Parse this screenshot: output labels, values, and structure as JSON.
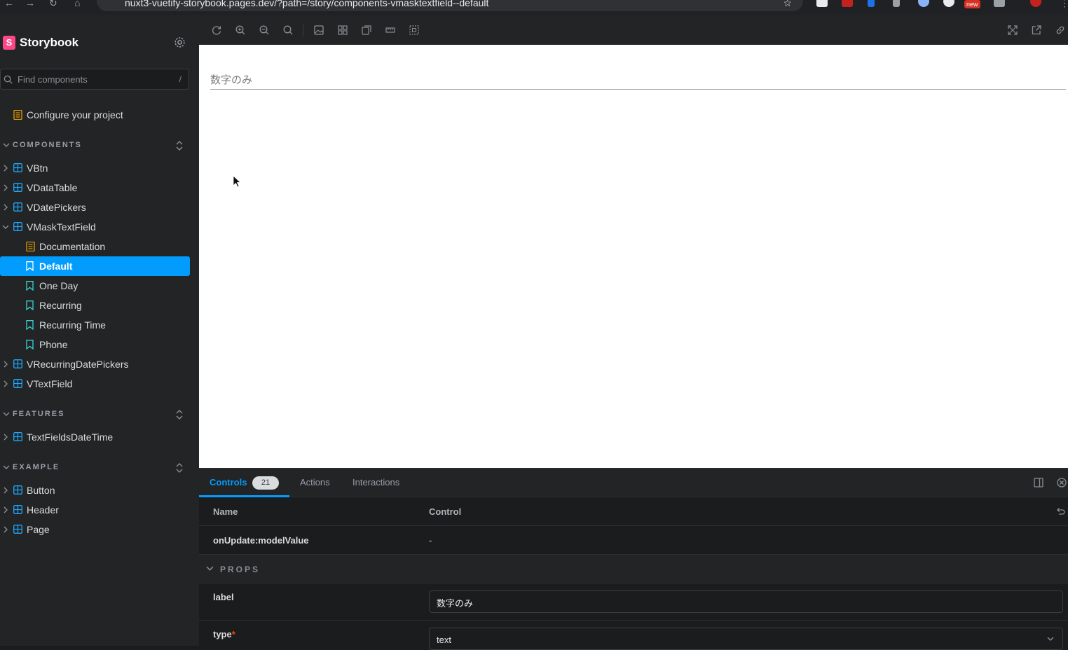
{
  "browser": {
    "url": "nuxt3-vuetify-storybook.pages.dev/?path=/story/components-vmasktextfield--default",
    "new_badge": "new"
  },
  "sidebar": {
    "brand": "Storybook",
    "search_placeholder": "Find components",
    "search_shortcut": "/",
    "configure": "Configure your project",
    "sections": {
      "components": "COMPONENTS",
      "features": "FEATURES",
      "example": "EXAMPLE"
    },
    "components": [
      "VBtn",
      "VDataTable",
      "VDatePickers",
      "VMaskTextField"
    ],
    "vmask_children": [
      "Documentation",
      "Default",
      "One Day",
      "Recurring",
      "Recurring Time",
      "Phone"
    ],
    "components_after": [
      "VRecurringDatePickers",
      "VTextField"
    ],
    "features": [
      "TextFieldsDateTime"
    ],
    "example": [
      "Button",
      "Header",
      "Page"
    ]
  },
  "canvas": {
    "field_label": "数字のみ"
  },
  "addons": {
    "tabs": [
      "Controls",
      "Actions",
      "Interactions"
    ],
    "controls_count": "21",
    "columns": {
      "name": "Name",
      "control": "Control"
    },
    "rows": {
      "event_name": "onUpdate:modelValue",
      "event_control": "-",
      "props_title": "PROPS",
      "label_name": "label",
      "label_value": "数字のみ",
      "type_name": "type",
      "type_required": "*",
      "type_value": "text"
    }
  },
  "colors": {
    "accent": "#029cfd",
    "brand": "#ff4785",
    "doc_icon": "#e69d00",
    "component_icon": "#1ea7fd",
    "story_icon": "#37d5d3"
  }
}
